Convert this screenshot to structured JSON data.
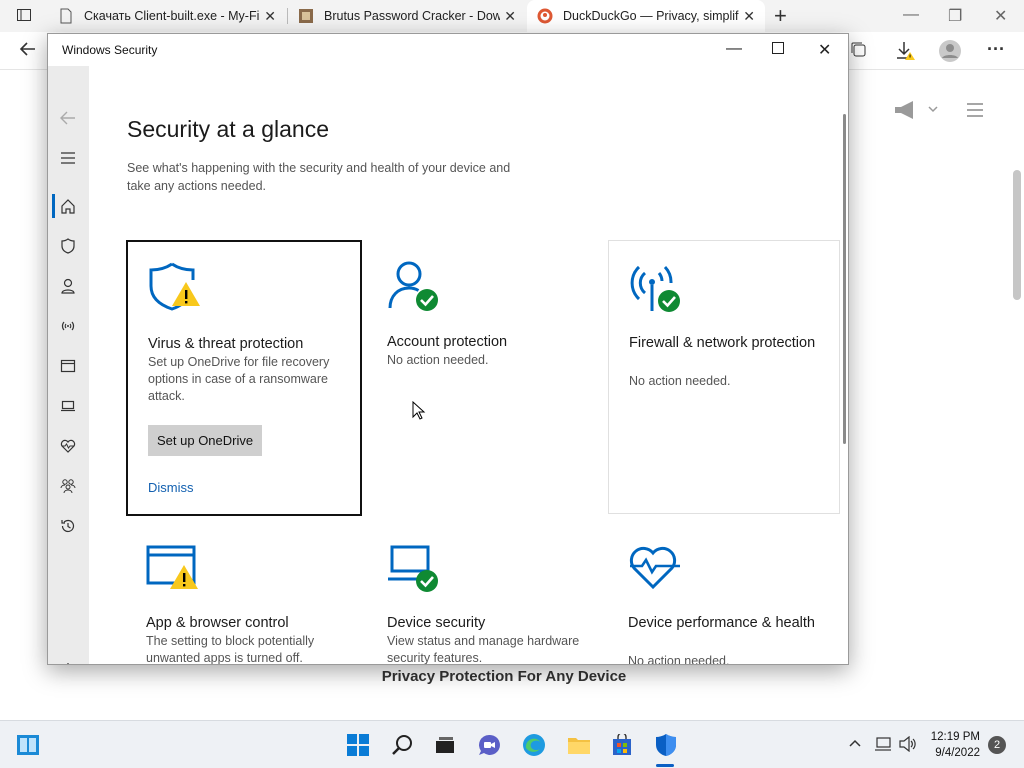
{
  "browser": {
    "tabs": [
      {
        "title": "Скачать Client-built.exe - My-Fi",
        "icon": "page-icon"
      },
      {
        "title": "Brutus Password Cracker - Down",
        "icon": "site-icon"
      },
      {
        "title": "DuckDuckGo — Privacy, simplifie",
        "icon": "duckduckgo-icon",
        "active": true
      }
    ],
    "new_tab": "+",
    "page_footer_text": "Privacy Protection For Any Device"
  },
  "security_window": {
    "title": "Windows Security",
    "heading": "Security at a glance",
    "subtitle": "See what's happening with the security and health of your device and take any actions needed.",
    "cards": [
      {
        "title": "Virus & threat protection",
        "description": "Set up OneDrive for file recovery options in case of a ransomware attack.",
        "button": "Set up OneDrive",
        "link": "Dismiss",
        "status": "warning"
      },
      {
        "title": "Account protection",
        "description": "No action needed.",
        "status": "ok"
      },
      {
        "title": "Firewall & network protection",
        "description": "No action needed.",
        "status": "ok"
      },
      {
        "title": "App & browser control",
        "description": "The setting to block potentially unwanted apps is turned off.",
        "status": "warning"
      },
      {
        "title": "Device security",
        "description": "View status and manage hardware security features.",
        "status": "ok"
      },
      {
        "title": "Device performance & health",
        "description": "No action needed.",
        "status": "ok"
      }
    ]
  },
  "taskbar": {
    "time": "12:19 PM",
    "date": "9/4/2022",
    "notifications": "2"
  },
  "colors": {
    "accent": "#0067c0",
    "ok_green": "#0f8a33",
    "warn_yellow": "#f8c81c",
    "link": "#1260b0"
  }
}
